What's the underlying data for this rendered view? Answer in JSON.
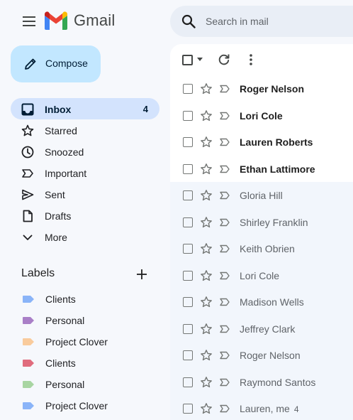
{
  "app": {
    "name": "Gmail"
  },
  "search": {
    "placeholder": "Search in mail"
  },
  "compose": {
    "label": "Compose"
  },
  "nav": [
    {
      "label": "Inbox",
      "count": "4",
      "icon": "inbox-icon",
      "active": true
    },
    {
      "label": "Starred",
      "icon": "star-icon"
    },
    {
      "label": "Snoozed",
      "icon": "clock-icon"
    },
    {
      "label": "Important",
      "icon": "important-icon"
    },
    {
      "label": "Sent",
      "icon": "send-icon"
    },
    {
      "label": "Drafts",
      "icon": "draft-icon"
    },
    {
      "label": "More",
      "icon": "chevron-down-icon"
    }
  ],
  "labels": {
    "title": "Labels",
    "items": [
      {
        "label": "Clients",
        "color": "#8ab4f8"
      },
      {
        "label": "Personal",
        "color": "#a97fc7"
      },
      {
        "label": "Project Clover",
        "color": "#f9cb9c"
      },
      {
        "label": "Clients",
        "color": "#e06c7d"
      },
      {
        "label": "Personal",
        "color": "#a8d5a2"
      },
      {
        "label": "Project Clover",
        "color": "#8ab4f8"
      }
    ]
  },
  "emails": [
    {
      "sender": "Roger Nelson",
      "unread": true
    },
    {
      "sender": "Lori Cole",
      "unread": true
    },
    {
      "sender": "Lauren Roberts",
      "unread": true
    },
    {
      "sender": "Ethan Lattimore",
      "unread": true
    },
    {
      "sender": "Gloria Hill",
      "unread": false
    },
    {
      "sender": "Shirley Franklin",
      "unread": false
    },
    {
      "sender": "Keith Obrien",
      "unread": false
    },
    {
      "sender": "Lori Cole",
      "unread": false
    },
    {
      "sender": "Madison Wells",
      "unread": false
    },
    {
      "sender": "Jeffrey Clark",
      "unread": false
    },
    {
      "sender": "Roger Nelson",
      "unread": false
    },
    {
      "sender": "Raymond Santos",
      "unread": false
    },
    {
      "sender": "Lauren, me",
      "count": "4",
      "unread": false
    }
  ],
  "colors": {
    "background": "#f6f8fc",
    "compose": "#c2e7ff",
    "nav_active": "#d3e3fd",
    "search": "#e9eef6"
  }
}
